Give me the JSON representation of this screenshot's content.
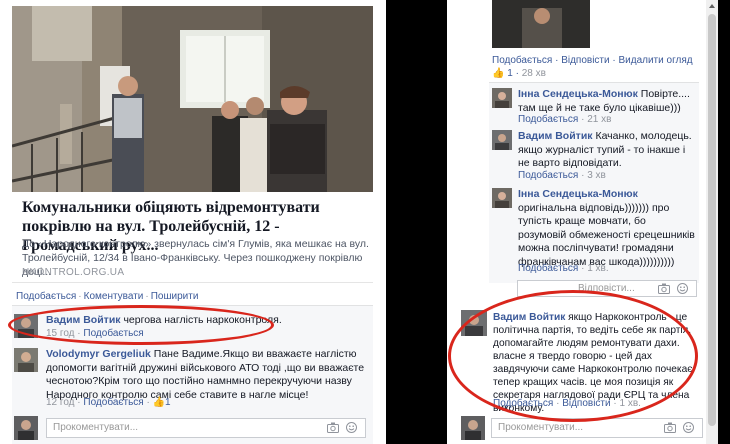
{
  "left": {
    "article": {
      "title": "Комунальники обіцяють відремонтувати покрівлю на вул. Тролейбусній, 12 - Громадський рух...",
      "description": "До «Народного контролю» звернулась сім'я Глумів, яка мешкає на вул. Тролейбусній, 12/34 в Івано-Франківську. Через пошкоджену покрівлю доці...",
      "domain": "NKONTROL.ORG.UA"
    },
    "actions": [
      "Подобається",
      "Коментувати",
      "Поширити"
    ],
    "comments": [
      {
        "author": "Вадим Войтик",
        "text": "чергова наглість наркоконтроля.",
        "time": "15 год",
        "actions": [
          "Подобається"
        ]
      },
      {
        "author": "Volodymyr Gergeliuk",
        "text": "Пане Вадиме.Якщо ви вважаєте наглістю допомогти вагітній дружині військового АТО тоді ,що ви вважаєте чеснотою?Крім того що постійно намнмно перекручуючи назву Народного контролю самі себе ставите в нагле місце!",
        "time": "12 год",
        "actions": [
          "Подобається"
        ],
        "likes": "1"
      }
    ],
    "reply_placeholder": "Прокоментувати..."
  },
  "right": {
    "top_actions": [
      "Подобається",
      "Відповісти",
      "Видалити огляд"
    ],
    "top_likes": "1",
    "top_time": "28 хв",
    "comments": [
      {
        "author": "Інна Сендецька-Монюк",
        "text": "Повірте.... там ще й не таке було цікавіше)))",
        "actions": [
          "Подобається"
        ],
        "time": "21 хв"
      },
      {
        "author": "Вадим Войтик",
        "text": "Качанко, молодець. якщо журналіст тупий - то інакше і не варто відповідати.",
        "actions": [
          "Подобається"
        ],
        "time": "3 хв"
      },
      {
        "author": "Інна Сендецька-Монюк",
        "text": "оригінальна відповідь))))))) про тупість краще мовчати, бо розумовій обмеженості єрецешників можна посліпчувати! громадяни франківчанам вас шкода))))))))))",
        "actions": [
          "Подобається"
        ],
        "time": "1 хв."
      }
    ],
    "big_comment": {
      "author": "Вадим Войтик",
      "text": "якщо Наркоконтроль - це політична партія, то ведіть себе як партія, допомагайте людям ремонтувати дахи. власне я твердо говорю - цей дах завдячуючи саме Наркоконтролю почекає тепер кращих часів. це моя позиція як секретаря наглядової ради ЄРЦ та члена виконкому.",
      "actions": [
        "Подобається",
        "Відповісти"
      ],
      "time": "1 хв."
    },
    "reply_placeholder_1": "Відповісти...",
    "reply_placeholder_2": "Прокоментувати..."
  },
  "colors": {
    "link": "#3b5998",
    "ellipse": "#d9261c",
    "meta": "#90949c",
    "comment_bg": "#f6f7f9"
  }
}
